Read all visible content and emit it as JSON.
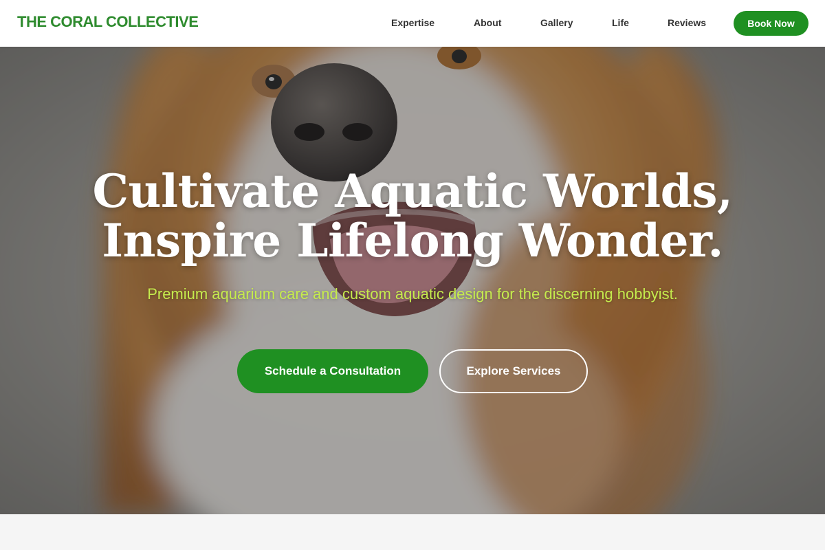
{
  "brand": {
    "name": "THE CORAL COLLECTIVE"
  },
  "nav": {
    "items": [
      {
        "label": "Expertise"
      },
      {
        "label": "About"
      },
      {
        "label": "Gallery"
      },
      {
        "label": "Life"
      },
      {
        "label": "Reviews"
      }
    ],
    "book_label": "Book Now"
  },
  "hero": {
    "headline_line1": "Cultivate Aquatic Worlds,",
    "headline_line2": "Inspire Lifelong Wonder.",
    "subtitle": "Premium aquarium care and custom aquatic design for the discerning hobbyist.",
    "primary_cta": "Schedule a Consultation",
    "secondary_cta": "Explore Services",
    "background_image": "dog-photo"
  },
  "colors": {
    "brand_green": "#2e8b2e",
    "button_green": "#1f9022",
    "subtitle_green": "#c5eb4d",
    "nav_text": "#333333",
    "page_background": "#f5f5f5"
  }
}
